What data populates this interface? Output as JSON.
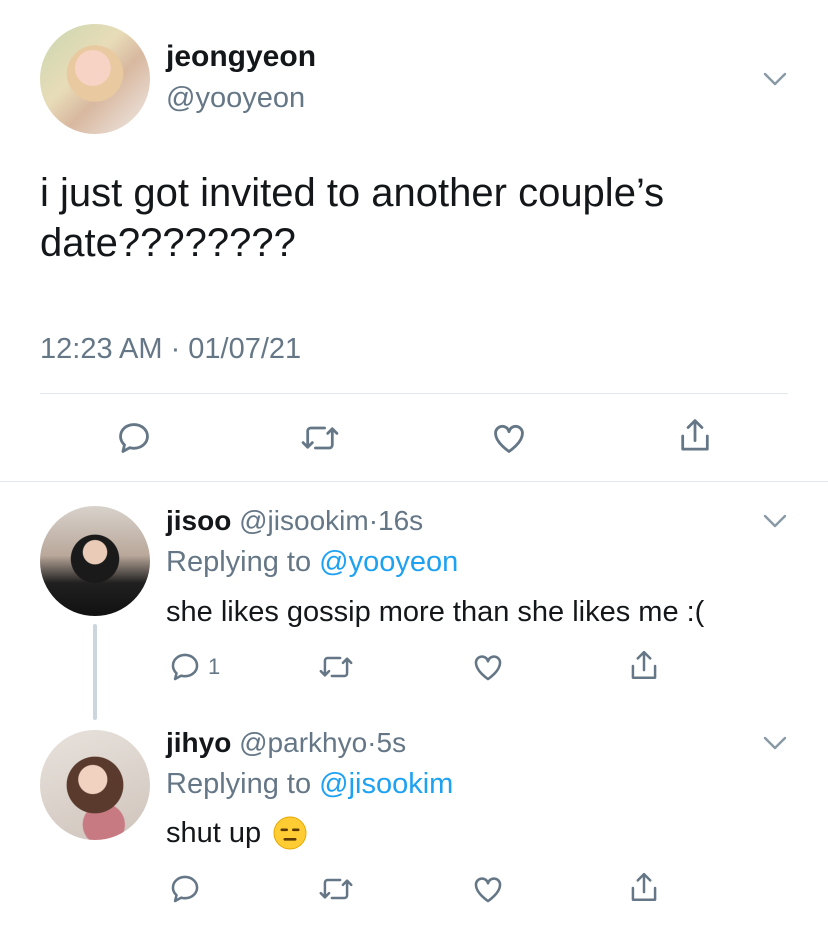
{
  "main_tweet": {
    "name": "jeongyeon",
    "handle": "@yooyeon",
    "text": "i just got invited to another couple’s date????????",
    "timestamp": "12:23 AM · 01/07/21"
  },
  "replies": [
    {
      "name": "jisoo",
      "handle": "@jisookim",
      "dot": "·",
      "time": "16s",
      "replying_prefix": "Replying to",
      "replying_to": "@yooyeon",
      "text": "she likes gossip more than she likes me :(",
      "reply_count": "1"
    },
    {
      "name": "jihyo",
      "handle": "@parkhyo",
      "dot": "·",
      "time": "5s",
      "replying_prefix": "Replying to",
      "replying_to": "@jisookim",
      "text": "shut up",
      "emoji": "expressionless-face"
    }
  ],
  "icons": [
    "chevron-down-icon",
    "reply-icon",
    "retweet-icon",
    "like-icon",
    "share-icon"
  ],
  "colors": {
    "text": "#14171a",
    "secondary": "#657786",
    "link": "#1da1f2",
    "divider": "#e1e8ed"
  }
}
